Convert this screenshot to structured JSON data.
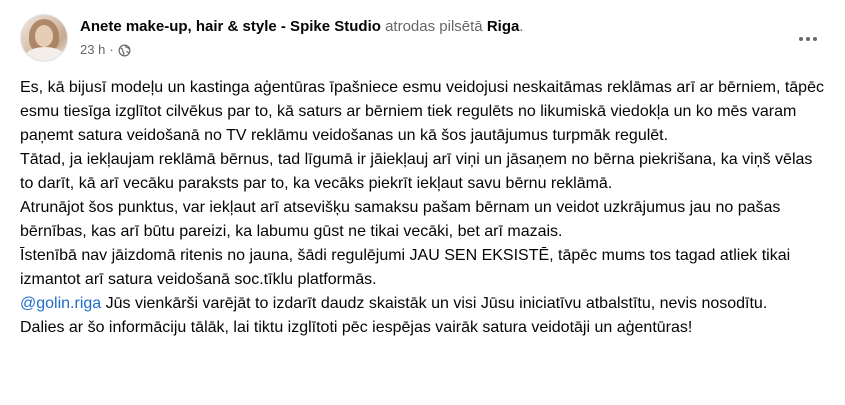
{
  "post": {
    "author": "Anete make-up, hair & style - Spike Studio",
    "location_prefix": "atrodas pilsētā",
    "location": "Riga",
    "location_suffix": ".",
    "time": "23 h",
    "separator": "·",
    "privacy_icon": "globe-icon",
    "more_icon": "more-options-icon",
    "paragraphs": [
      "Es, kā bijusī modeļu un kastinga aģentūras īpašniece esmu veidojusi neskaitāmas reklāmas arī ar bērniem, tāpēc esmu tiesīga izglītot cilvēkus par to, kā saturs ar bērniem tiek regulēts no likumiskā viedokļa un ko mēs varam paņemt satura veidošanā no TV reklāmu veidošanas un kā šos jautājumus turpmāk regulēt.",
      "Tātad, ja iekļaujam reklāmā bērnus, tad līgumā ir jāiekļauj arī viņi un jāsaņem no bērna piekrišana, ka viņš vēlas to darīt, kā arī vecāku paraksts par to, ka vecāks piekrīt iekļaut savu bērnu reklāmā.",
      "Atrunājot šos punktus, var iekļaut arī atsevišķu samaksu pašam bērnam un veidot uzkrājumus jau no pašas bērnības, kas arī būtu pareizi, ka labumu gūst ne tikai vecāki, bet arī mazais.",
      "Īstenībā nav jāizdomā ritenis no jauna, šādi regulējumi JAU SEN EKSISTĒ, tāpēc mums tos tagad atliek tikai izmantot arī satura veidošanā soc.tīklu platformās."
    ],
    "mention": "@golin.riga",
    "mention_text": " Jūs vienkārši varējāt to izdarīt daudz skaistāk un visi Jūsu iniciatīvu atbalstītu, nevis nosodītu.",
    "closing": "Dalies ar šo informāciju tālāk, lai tiktu izglītoti pēc iespējas vairāk satura veidotāji un aģentūras!"
  },
  "colors": {
    "text": "#050505",
    "secondary": "#65676b",
    "link": "#1d6ec7",
    "background": "#ffffff"
  }
}
